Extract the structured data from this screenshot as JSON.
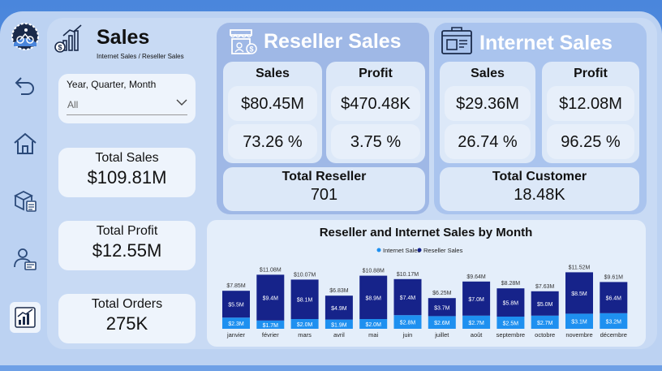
{
  "header": {
    "title": "Sales",
    "subtitle": "Internet Sales / Reseller Sales"
  },
  "filter": {
    "label": "Year, Quarter, Month",
    "value": "All"
  },
  "kpis": {
    "total_sales_label": "Total Sales",
    "total_sales_value": "$109.81M",
    "total_profit_label": "Total Profit",
    "total_profit_value": "$12.55M",
    "total_orders_label": "Total Orders",
    "total_orders_value": "275K"
  },
  "reseller": {
    "title": "Reseller Sales",
    "sales_label": "Sales",
    "sales_value": "$80.45M",
    "sales_pct": "73.26 %",
    "profit_label": "Profit",
    "profit_value": "$470.48K",
    "profit_pct": "3.75  %",
    "total_label": "Total Reseller",
    "total_value": "701"
  },
  "internet": {
    "title": "Internet Sales",
    "sales_label": "Sales",
    "sales_value": "$29.36M",
    "sales_pct": "26.74 %",
    "profit_label": "Profit",
    "profit_value": "$12.08M",
    "profit_pct": "96.25  %",
    "total_label": "Total Customer",
    "total_value": "18.48K"
  },
  "colors": {
    "internet": "#1e90f0",
    "reseller": "#16238a",
    "accent": "#ffffff"
  },
  "chart_data": {
    "type": "bar",
    "stacked": true,
    "title": "Reseller and Internet Sales by Month",
    "legend_position": "top-center",
    "categories": [
      "janvier",
      "février",
      "mars",
      "avril",
      "mai",
      "juin",
      "juillet",
      "août",
      "septembre",
      "octobre",
      "novembre",
      "décembre"
    ],
    "series": [
      {
        "name": "Internet Sales",
        "values": [
          2.3,
          1.7,
          2.0,
          1.9,
          2.0,
          2.8,
          2.6,
          2.7,
          2.5,
          2.7,
          3.1,
          3.2
        ],
        "labels": [
          "$2.3M",
          "$1.7M",
          "$2.0M",
          "$1.9M",
          "$2.0M",
          "$2.8M",
          "$2.6M",
          "$2.7M",
          "$2.5M",
          "$2.7M",
          "$3.1M",
          "$3.2M"
        ]
      },
      {
        "name": "Reseller Sales",
        "values": [
          5.5,
          9.4,
          8.1,
          4.9,
          8.9,
          7.4,
          3.7,
          7.0,
          5.8,
          5.0,
          8.5,
          6.4
        ],
        "labels": [
          "$5.5M",
          "$9.4M",
          "$8.1M",
          "$4.9M",
          "$8.9M",
          "$7.4M",
          "$3.7M",
          "$7.0M",
          "$5.8M",
          "$5.0M",
          "$8.5M",
          "$6.4M"
        ]
      }
    ],
    "totals": [
      7.85,
      11.08,
      10.07,
      6.83,
      10.88,
      10.17,
      6.25,
      9.64,
      8.28,
      7.63,
      11.52,
      9.61
    ],
    "total_labels": [
      "$7.85M",
      "$11.08M",
      "$10.07M",
      "$6.83M",
      "$10.88M",
      "$10.17M",
      "$6.25M",
      "$9.64M",
      "$8.28M",
      "$7.63M",
      "$11.52M",
      "$9.61M"
    ],
    "ylim": [
      0,
      12
    ],
    "grid": false
  }
}
